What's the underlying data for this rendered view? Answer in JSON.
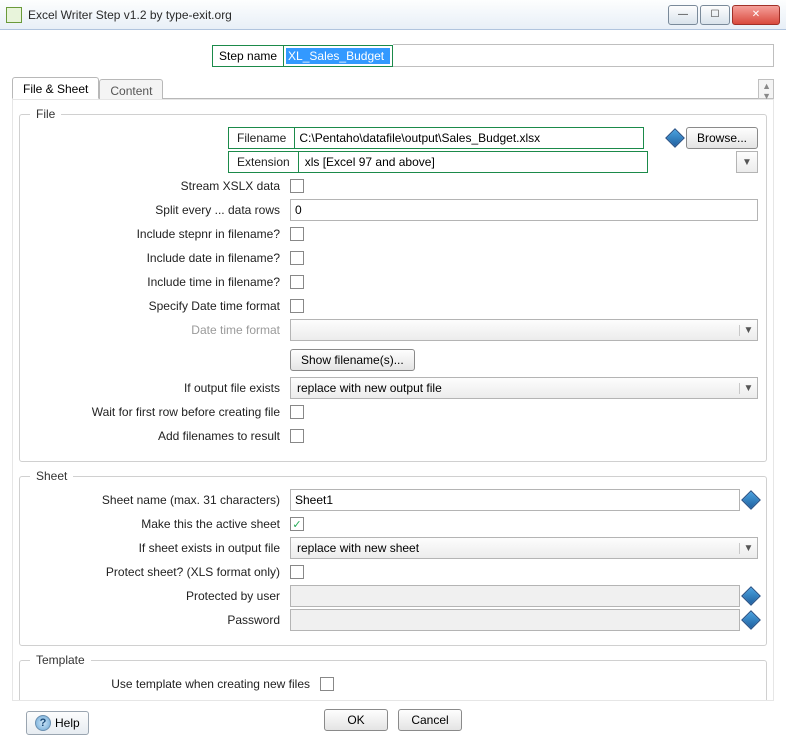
{
  "window": {
    "title": "Excel Writer Step v1.2 by type-exit.org"
  },
  "stepname": {
    "label": "Step name",
    "value": "XL_Sales_Budget"
  },
  "tabs": {
    "file_sheet": "File & Sheet",
    "content": "Content"
  },
  "file": {
    "group": "File",
    "filename_label": "Filename",
    "filename_value": "C:\\Pentaho\\datafile\\output\\Sales_Budget.xlsx",
    "browse": "Browse...",
    "extension_label": "Extension",
    "extension_value": "xls [Excel 97 and above]",
    "stream_label": "Stream XSLX data",
    "split_label": "Split every ... data rows",
    "split_value": "0",
    "stepnr_label": "Include stepnr in filename?",
    "date_label": "Include date in filename?",
    "time_label": "Include time in filename?",
    "specfmt_label": "Specify Date time format",
    "dtf_label": "Date time format",
    "show_btn": "Show filename(s)...",
    "exists_label": "If output file exists",
    "exists_value": "replace with new output file",
    "wait_label": "Wait for first row before creating file",
    "addfn_label": "Add filenames to result"
  },
  "sheet": {
    "group": "Sheet",
    "name_label": "Sheet name (max. 31 characters)",
    "name_value": "Sheet1",
    "active_label": "Make this the active sheet",
    "exists_label": "If sheet exists in output file",
    "exists_value": "replace with new sheet",
    "protect_label": "Protect sheet? (XLS format only)",
    "user_label": "Protected by user",
    "pwd_label": "Password"
  },
  "template": {
    "group": "Template",
    "use_label": "Use template when creating new files"
  },
  "buttons": {
    "ok": "OK",
    "cancel": "Cancel",
    "help": "Help"
  }
}
